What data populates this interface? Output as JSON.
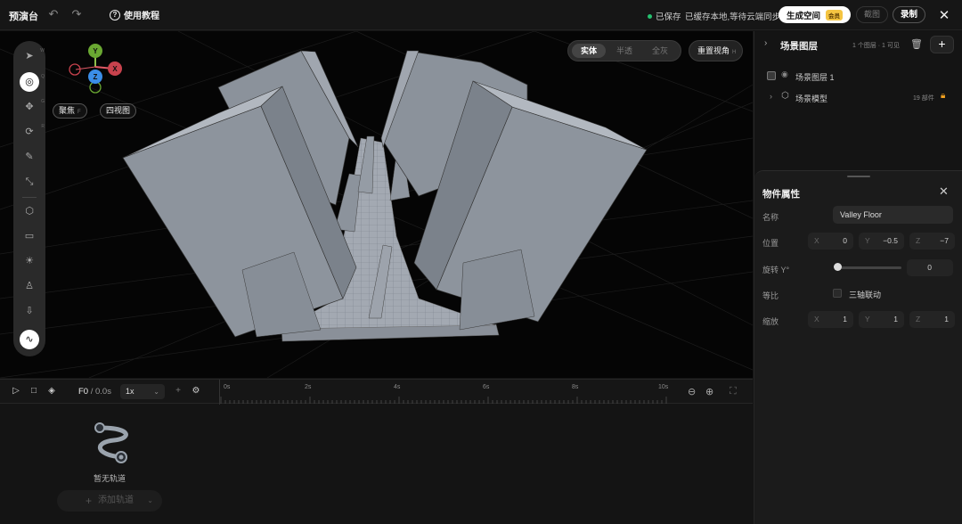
{
  "topbar": {
    "app_title": "预演台",
    "tutorial_label": "使用教程",
    "save_status": "已保存",
    "cache_status": "已缓存本地,等待云端同步",
    "generate_label": "生成空间",
    "member_badge": "会员",
    "screenshot_label": "截图",
    "record_label": "录制"
  },
  "toolbar": {
    "tools": [
      {
        "icon": "select-arrow-icon",
        "key": "W"
      },
      {
        "icon": "orbit-icon",
        "key": "Q",
        "active": true
      },
      {
        "icon": "move-icon",
        "key": "G"
      },
      {
        "icon": "rotate-icon",
        "key": "R"
      },
      {
        "icon": "pen-icon"
      },
      {
        "icon": "scale-icon"
      },
      {
        "icon": "cube-icon"
      },
      {
        "icon": "camera-icon"
      },
      {
        "icon": "light-icon"
      },
      {
        "icon": "person-icon"
      },
      {
        "icon": "import-icon"
      },
      {
        "icon": "path-icon"
      }
    ]
  },
  "viewport": {
    "view_modes": [
      "实体",
      "半透",
      "全灰"
    ],
    "active_view_mode": "实体",
    "reset_view_label": "重置视角",
    "reset_view_key": "H",
    "focus_label": "聚焦",
    "focus_key": "F",
    "quad_view_label": "四视图",
    "gizmo": {
      "y": "Y",
      "x": "X",
      "z": "Z",
      "y_color": "#6aa832",
      "x_color": "#d9414c",
      "z_color": "#3b8ee8"
    }
  },
  "layers": {
    "title": "场景图层",
    "count_text": "1 个图层 · 1 可见",
    "items": [
      {
        "label": "场景图层 1"
      },
      {
        "label": "场景模型",
        "parts": "19 部件"
      }
    ]
  },
  "properties": {
    "title": "物件属性",
    "name_label": "名称",
    "name_value": "Valley Floor",
    "position_label": "位置",
    "position": {
      "x": "0",
      "y": "−0.5",
      "z": "−7"
    },
    "rotation_label": "旋转 Y°",
    "rotation_value": "0",
    "uniform_label": "等比",
    "axis_link_label": "三轴联动",
    "scale_label": "缩放",
    "scale": {
      "x": "1",
      "y": "1",
      "z": "1"
    },
    "axis_x": "X",
    "axis_y": "Y",
    "axis_z": "Z"
  },
  "timeline": {
    "frame": "F0",
    "duration": "/ 0.0s",
    "speed": "1x",
    "ruler_labels": [
      "0s",
      "2s",
      "4s",
      "6s",
      "8s",
      "10s"
    ],
    "empty_text": "暂无轨道",
    "add_track_label": "添加轨道"
  }
}
